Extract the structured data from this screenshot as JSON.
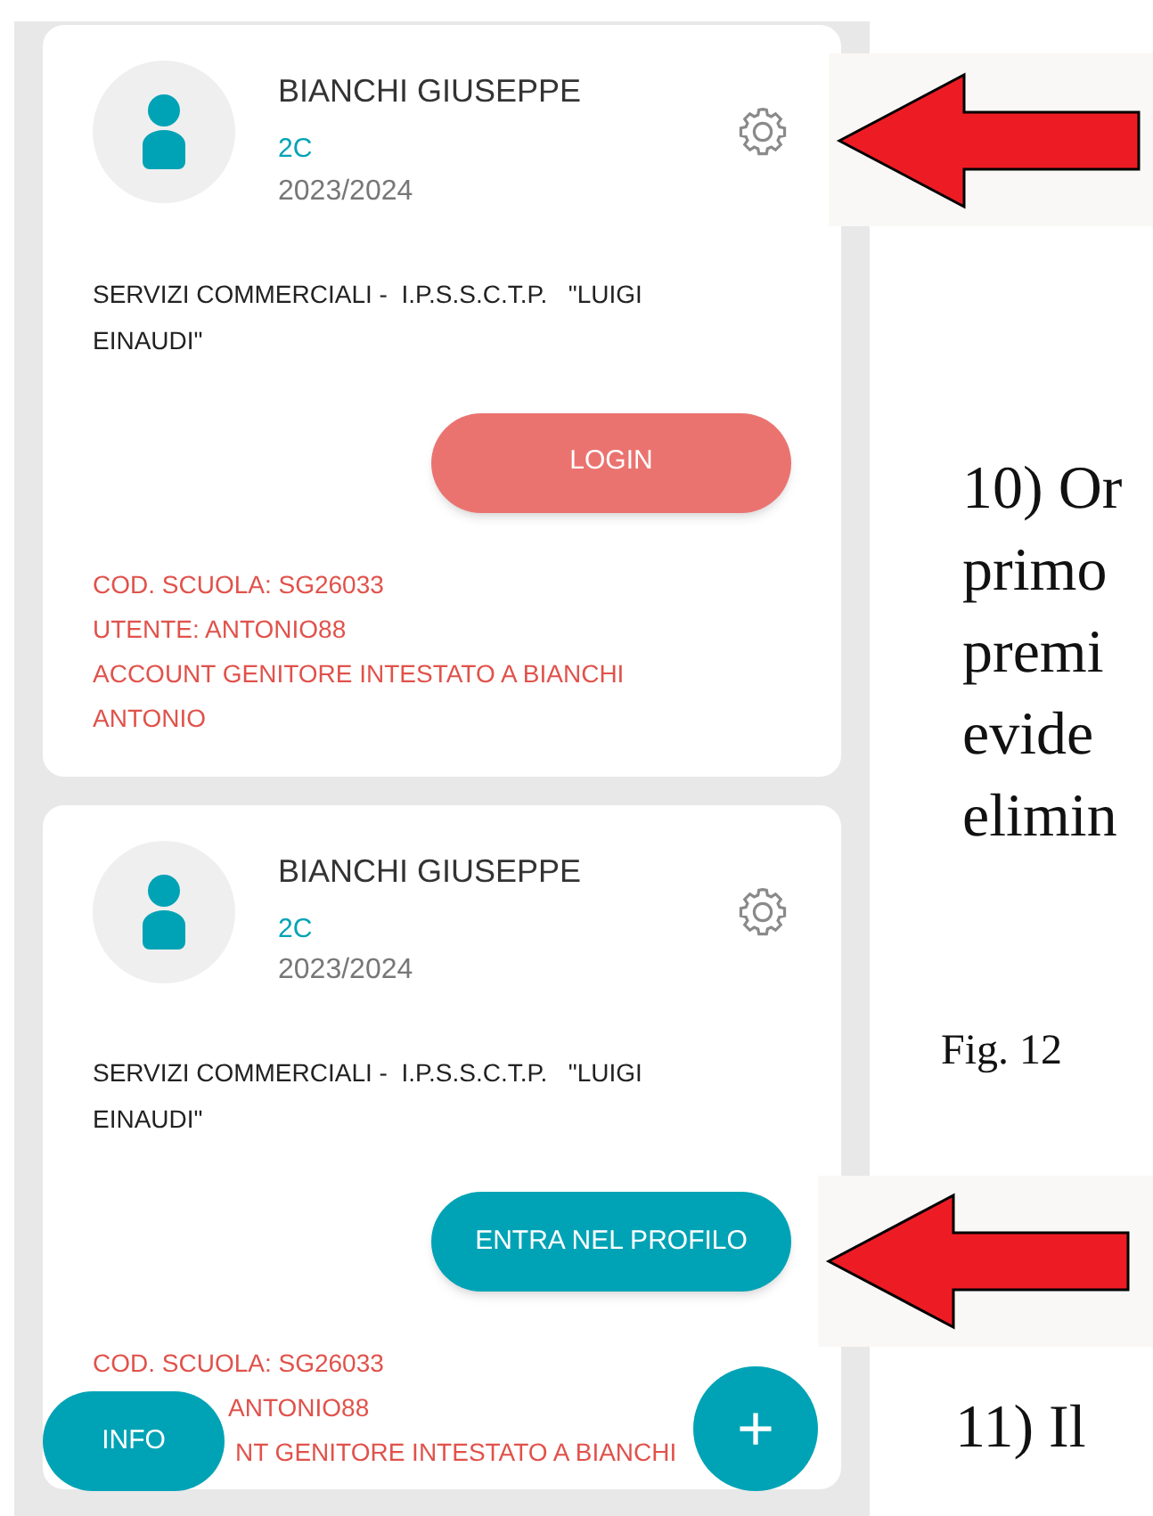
{
  "cards": [
    {
      "name": "BIANCHI GIUSEPPE",
      "class": "2C",
      "year": "2023/2024",
      "school": "SERVIZI COMMERCIALI -  I.P.S.S.C.T.P.   \"LUIGI EINAUDI\"",
      "button": {
        "label": "LOGIN",
        "kind": "login"
      },
      "details": [
        "COD. SCUOLA: SG26033",
        "UTENTE: ANTONIO88",
        "ACCOUNT GENITORE INTESTATO A BIANCHI ANTONIO"
      ]
    },
    {
      "name": "BIANCHI GIUSEPPE",
      "class": "2C",
      "year": "2023/2024",
      "school": "SERVIZI COMMERCIALI -  I.P.S.S.C.T.P.   \"LUIGI EINAUDI\"",
      "button": {
        "label": "ENTRA NEL PROFILO",
        "kind": "enter"
      },
      "details": [
        "COD. SCUOLA: SG26033",
        "ANTONIO88",
        "NT GENITORE INTESTATO A BIANCHI"
      ]
    }
  ],
  "info_button": "INFO",
  "add_button": "+",
  "document": {
    "paragraph_1": [
      "10) Or",
      "primo",
      "premi",
      "evide",
      "elimin"
    ],
    "caption": "Fig. 12",
    "paragraph_2": "11) Il"
  }
}
